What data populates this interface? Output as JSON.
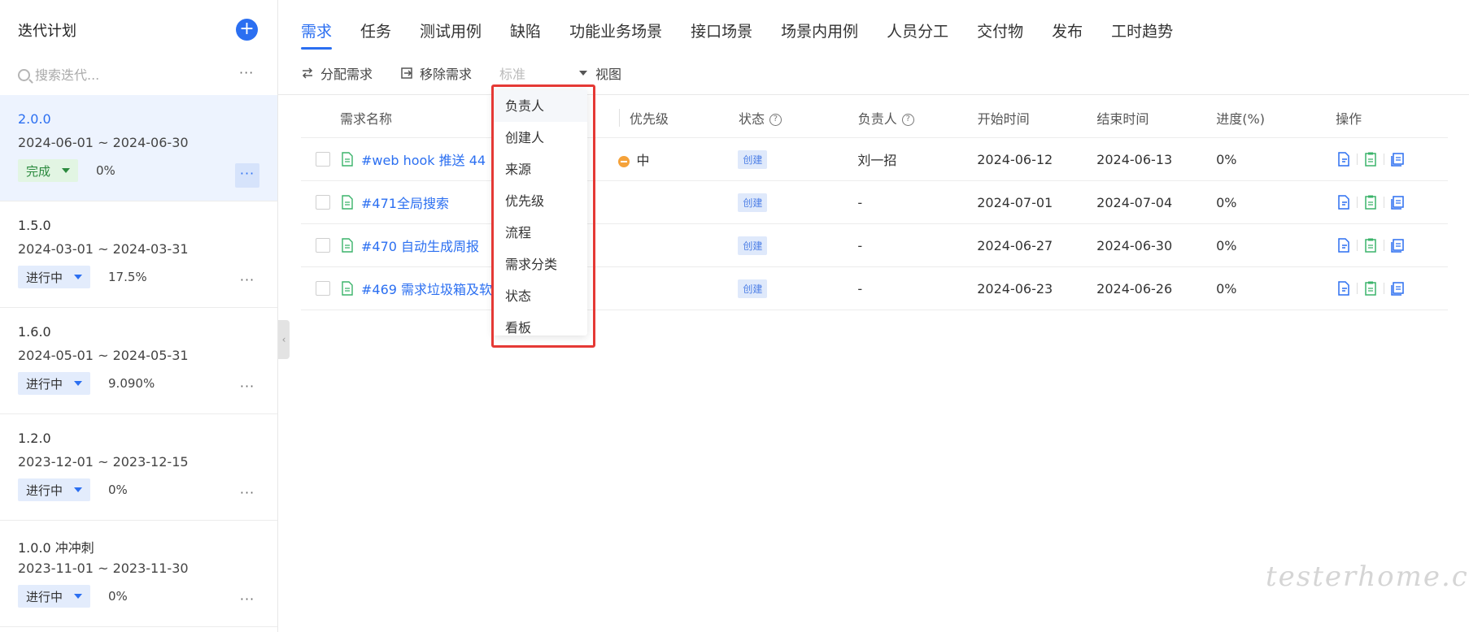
{
  "sidebar": {
    "title": "迭代计划",
    "add_label": "+",
    "search_placeholder": "搜索迭代...",
    "more_label": "···",
    "iterations": [
      {
        "version": "2.0.0",
        "range": "2024-06-01 ~ 2024-06-30",
        "status": "完成",
        "progress": "0%",
        "active": true
      },
      {
        "version": "1.5.0",
        "range": "2024-03-01 ~ 2024-03-31",
        "status": "进行中",
        "progress": "17.5%",
        "active": false
      },
      {
        "version": "1.6.0",
        "range": "2024-05-01 ~ 2024-05-31",
        "status": "进行中",
        "progress": "9.090%",
        "active": false
      },
      {
        "version": "1.2.0",
        "range": "2023-12-01 ~ 2023-12-15",
        "status": "进行中",
        "progress": "0%",
        "active": false
      },
      {
        "version": "1.0.0 冲冲刺",
        "range": "2023-11-01 ~ 2023-11-30",
        "status": "进行中",
        "progress": "0%",
        "active": false
      }
    ]
  },
  "tabs": [
    "需求",
    "任务",
    "测试用例",
    "缺陷",
    "功能业务场景",
    "接口场景",
    "场景内用例",
    "人员分工",
    "交付物",
    "发布",
    "工时趋势"
  ],
  "toolbar": {
    "assign": "分配需求",
    "remove": "移除需求",
    "standard": "标准",
    "view": "视图"
  },
  "table": {
    "headers": {
      "name": "需求名称",
      "priority": "优先级",
      "status": "状态",
      "owner": "负责人",
      "start": "开始时间",
      "end": "结束时间",
      "progress": "进度(%)",
      "ops": "操作"
    },
    "rows": [
      {
        "name": "#web hook 推送 44",
        "priority": "中",
        "status": "创建",
        "owner": "刘一招",
        "start": "2024-06-12",
        "end": "2024-06-13",
        "progress": "0%"
      },
      {
        "name": "#471全局搜索",
        "priority": "",
        "status": "创建",
        "owner": "-",
        "start": "2024-07-01",
        "end": "2024-07-04",
        "progress": "0%"
      },
      {
        "name": "#470 自动生成周报",
        "priority": "",
        "status": "创建",
        "owner": "-",
        "start": "2024-06-27",
        "end": "2024-06-30",
        "progress": "0%"
      },
      {
        "name": "#469 需求垃圾箱及软",
        "priority": "",
        "status": "创建",
        "owner": "-",
        "start": "2024-06-23",
        "end": "2024-06-26",
        "progress": "0%"
      }
    ]
  },
  "dropdown": {
    "items": [
      "负责人",
      "创建人",
      "来源",
      "优先级",
      "流程",
      "需求分类",
      "状态",
      "看板"
    ]
  },
  "watermark": "testerhome.com",
  "colors": {
    "accent": "#2b6ff1",
    "highlight": "#e53935",
    "done_bg": "#e2f5e3",
    "progress_bg": "#e3ecfc"
  }
}
